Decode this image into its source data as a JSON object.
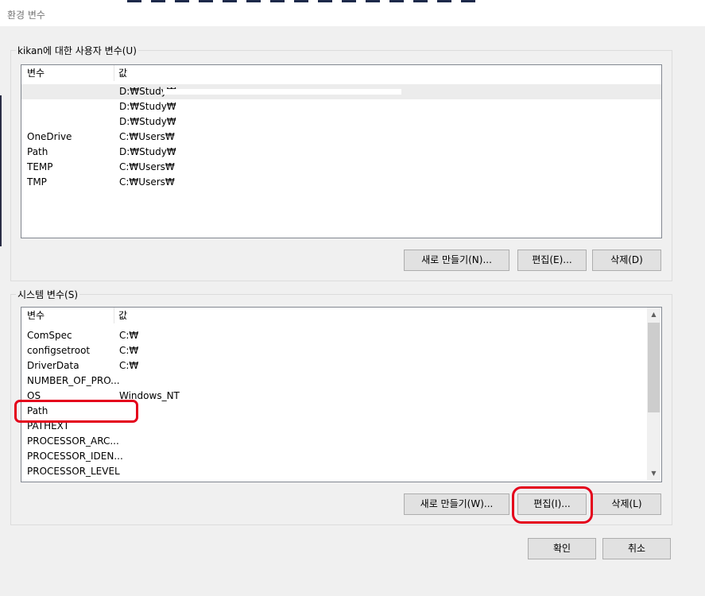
{
  "window": {
    "title": "환경 변수"
  },
  "user_vars": {
    "group_label": "kikan에 대한 사용자 변수(U)",
    "headers": {
      "name": "변수",
      "value": "값"
    },
    "rows": [
      {
        "name": "",
        "value": "D:₩Study₩"
      },
      {
        "name": "",
        "value": "D:₩Study₩"
      },
      {
        "name": "",
        "value": "D:₩Study₩"
      },
      {
        "name": "OneDrive",
        "value": "C:₩Users₩"
      },
      {
        "name": "Path",
        "value": "D:₩Study₩"
      },
      {
        "name": "TEMP",
        "value": "C:₩Users₩"
      },
      {
        "name": "TMP",
        "value": "C:₩Users₩"
      }
    ],
    "buttons": {
      "new": "새로 만들기(N)...",
      "edit": "편집(E)...",
      "delete": "삭제(D)"
    }
  },
  "system_vars": {
    "group_label": "시스템 변수(S)",
    "headers": {
      "name": "변수",
      "value": "값"
    },
    "rows": [
      {
        "name": "ComSpec",
        "value": "C:₩"
      },
      {
        "name": "configsetroot",
        "value": "C:₩"
      },
      {
        "name": "DriverData",
        "value": "C:₩"
      },
      {
        "name": "NUMBER_OF_PRO...",
        "value": ""
      },
      {
        "name": "OS",
        "value": "Windows_NT"
      },
      {
        "name": "Path",
        "value": ""
      },
      {
        "name": "PATHEXT",
        "value": ""
      },
      {
        "name": "PROCESSOR_ARC...",
        "value": ""
      },
      {
        "name": "PROCESSOR_IDEN...",
        "value": ""
      },
      {
        "name": "PROCESSOR_LEVEL",
        "value": ""
      }
    ],
    "buttons": {
      "new": "새로 만들기(W)...",
      "edit": "편집(I)...",
      "delete": "삭제(L)"
    }
  },
  "footer": {
    "ok": "확인",
    "cancel": "취소"
  },
  "colors": {
    "highlight_ring": "#e4001b",
    "background": "#f0f0f0"
  }
}
